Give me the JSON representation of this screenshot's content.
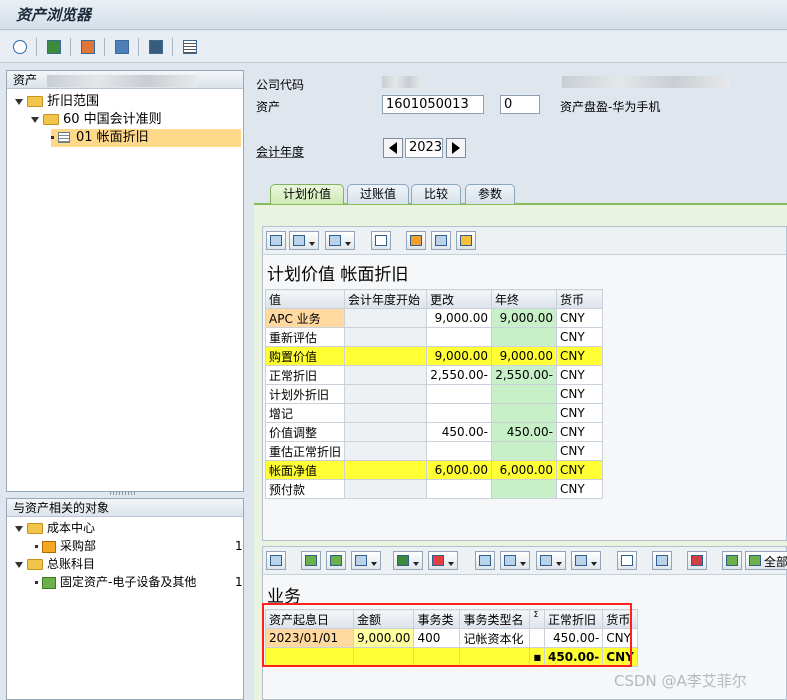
{
  "window": {
    "title": "资产浏览器"
  },
  "toolbar": {
    "icons": [
      "refresh-icon",
      "save-icon",
      "hierarchy-icon",
      "org-icon",
      "settings-icon",
      "list-icon"
    ]
  },
  "left_tree": {
    "header": "资产",
    "nodes": [
      {
        "label": "折旧范围",
        "level": 1
      },
      {
        "label": "60  中国会计准则",
        "level": 2
      },
      {
        "label": "01  帐面折旧",
        "level": 3
      }
    ]
  },
  "related": {
    "header": "与资产相关的对象",
    "nodes": [
      {
        "label": "成本中心",
        "level": 1
      },
      {
        "label": "采购部",
        "level": 2,
        "count": "1"
      },
      {
        "label": "总账科目",
        "level": 1
      },
      {
        "label": "固定资产-电子设备及其他",
        "level": 2,
        "count": "1"
      }
    ]
  },
  "header": {
    "company_code_label": "公司代码",
    "asset_label": "资产",
    "asset_number": "1601050013",
    "asset_sub": "0",
    "asset_desc": "资产盘盈-华为手机",
    "fiscal_year_label": "会计年度",
    "fiscal_year": "2023"
  },
  "tabs": [
    "计划价值",
    "过账值",
    "比较",
    "参数"
  ],
  "planned": {
    "title": "计划价值 帐面折旧",
    "columns": [
      "值",
      "会计年度开始",
      "更改",
      "年终",
      "货币"
    ],
    "rows": [
      {
        "name": "APC 业务",
        "start": "",
        "change": "9,000.00",
        "year_end": "9,000.00",
        "currency": "CNY",
        "style": "orange"
      },
      {
        "name": "重新评估",
        "start": "",
        "change": "",
        "year_end": "",
        "currency": "CNY",
        "style": "plain"
      },
      {
        "name": "购置价值",
        "start": "",
        "change": "9,000.00",
        "year_end": "9,000.00",
        "currency": "CNY",
        "style": "yellow"
      },
      {
        "name": "正常折旧",
        "start": "",
        "change": "2,550.00-",
        "year_end": "2,550.00-",
        "currency": "CNY",
        "style": "plain"
      },
      {
        "name": "计划外折旧",
        "start": "",
        "change": "",
        "year_end": "",
        "currency": "CNY",
        "style": "plain"
      },
      {
        "name": "增记",
        "start": "",
        "change": "",
        "year_end": "",
        "currency": "CNY",
        "style": "plain"
      },
      {
        "name": "价值调整",
        "start": "",
        "change": "450.00-",
        "year_end": "450.00-",
        "currency": "CNY",
        "style": "plain"
      },
      {
        "name": "重估正常折旧",
        "start": "",
        "change": "",
        "year_end": "",
        "currency": "CNY",
        "style": "plain"
      },
      {
        "name": "帐面净值",
        "start": "",
        "change": "6,000.00",
        "year_end": "6,000.00",
        "currency": "CNY",
        "style": "yellow"
      },
      {
        "name": "预付款",
        "start": "",
        "change": "",
        "year_end": "",
        "currency": "CNY",
        "style": "plain"
      }
    ]
  },
  "transactions": {
    "title": "业务",
    "all_label": "全部",
    "columns": [
      "资产起息日",
      "金额",
      "事务类",
      "事务类型名",
      "Σ",
      "正常折旧",
      "货币"
    ],
    "rows": [
      {
        "date": "2023/01/01",
        "amount": "9,000.00",
        "type": "400",
        "type_name": "记帐资本化",
        "dep": "450.00-",
        "currency": "CNY"
      }
    ],
    "total": {
      "marker": "■",
      "dep": "450.00-",
      "currency": "CNY"
    }
  },
  "watermark": "CSDN @A李艾菲尔"
}
